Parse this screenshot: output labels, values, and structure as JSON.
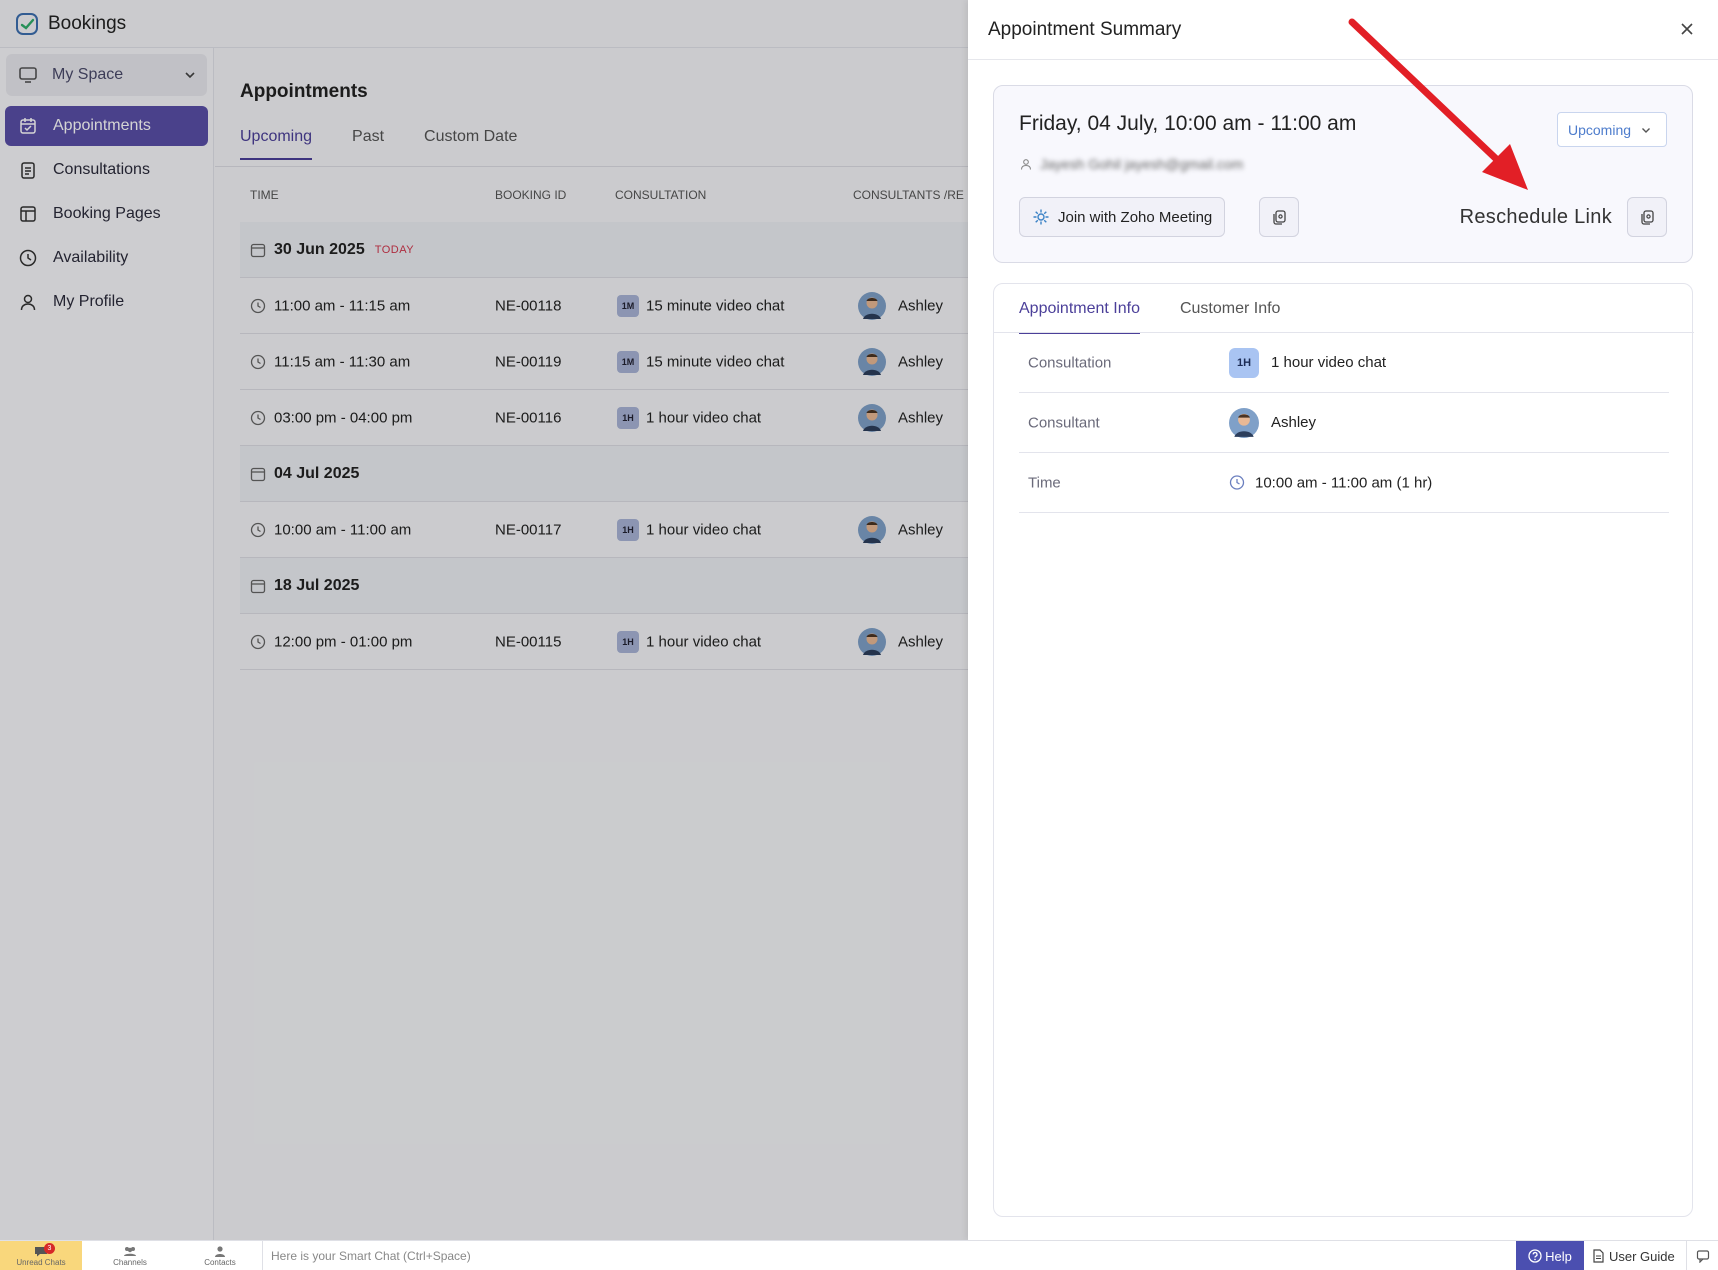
{
  "app": {
    "title": "Bookings"
  },
  "space": {
    "label": "My Space"
  },
  "nav": [
    {
      "label": "Appointments",
      "icon": "calendar-icon"
    },
    {
      "label": "Consultations",
      "icon": "clipboard-icon"
    },
    {
      "label": "Booking Pages",
      "icon": "window-icon"
    },
    {
      "label": "Availability",
      "icon": "clock-icon"
    },
    {
      "label": "My Profile",
      "icon": "user-icon"
    }
  ],
  "main": {
    "title": "Appointments",
    "tabs": [
      "Upcoming",
      "Past",
      "Custom Date"
    ],
    "columns": [
      "TIME",
      "BOOKING ID",
      "CONSULTATION",
      "CONSULTANTS /RE"
    ],
    "groups": [
      {
        "date": "30 Jun 2025",
        "tag": "TODAY",
        "rows": [
          {
            "time": "11:00 am - 11:15 am",
            "id": "NE-00118",
            "badge": "1M",
            "consultation": "15 minute video chat",
            "consultant": "Ashley"
          },
          {
            "time": "11:15 am - 11:30 am",
            "id": "NE-00119",
            "badge": "1M",
            "consultation": "15 minute video chat",
            "consultant": "Ashley"
          },
          {
            "time": "03:00 pm - 04:00 pm",
            "id": "NE-00116",
            "badge": "1H",
            "consultation": "1 hour video chat",
            "consultant": "Ashley"
          }
        ]
      },
      {
        "date": "04 Jul 2025",
        "tag": "",
        "rows": [
          {
            "time": "10:00 am - 11:00 am",
            "id": "NE-00117",
            "badge": "1H",
            "consultation": "1 hour video chat",
            "consultant": "Ashley"
          }
        ]
      },
      {
        "date": "18 Jul 2025",
        "tag": "",
        "rows": [
          {
            "time": "12:00 pm - 01:00 pm",
            "id": "NE-00115",
            "badge": "1H",
            "consultation": "1 hour video chat",
            "consultant": "Ashley"
          }
        ]
      }
    ]
  },
  "drawer": {
    "title": "Appointment Summary",
    "when": "Friday, 04 July, 10:00 am - 11:00 am",
    "customer_blurred": "Jayesh Gohil  jayesh@gmail.com",
    "status": "Upcoming",
    "join_label": "Join with Zoho Meeting",
    "reschedule_label": "Reschedule Link",
    "info_tabs": [
      "Appointment Info",
      "Customer Info"
    ],
    "info": {
      "consultation_key": "Consultation",
      "consultation_badge": "1H",
      "consultation_value": "1 hour video chat",
      "consultant_key": "Consultant",
      "consultant_value": "Ashley",
      "time_key": "Time",
      "time_value": "10:00 am - 11:00 am (1 hr)"
    }
  },
  "bottombar": {
    "unread_label": "Unread Chats",
    "unread_count": "3",
    "channels_label": "Channels",
    "contacts_label": "Contacts",
    "smart_chat": "Here is your Smart Chat (Ctrl+Space)",
    "help": "Help",
    "guide": "User Guide"
  },
  "colors": {
    "accent": "#5a4fa8",
    "today": "#d2374d",
    "annotation": "#e21f26",
    "status": "#4d7ccc"
  }
}
